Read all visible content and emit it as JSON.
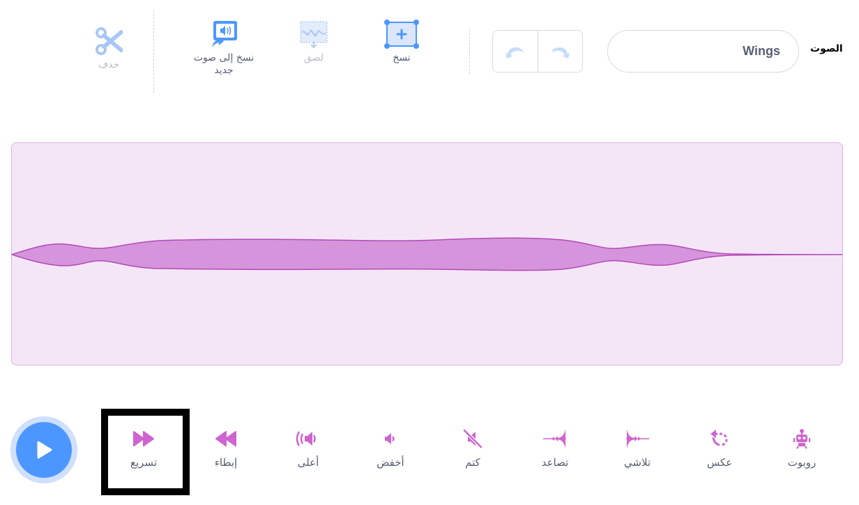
{
  "sound_name": {
    "label": "الصوت",
    "value": "Wings"
  },
  "history": {
    "undo_icon": "undo-icon",
    "redo_icon": "redo-icon"
  },
  "toolbar": {
    "copy": {
      "label": "نسخ",
      "icon": "copy-selection-icon"
    },
    "paste": {
      "label": "لصق",
      "icon": "paste-icon"
    },
    "copy_to_new": {
      "label": "نسخ إلى صوت جديد",
      "icon": "copy-to-new-icon"
    },
    "delete": {
      "label": "حذف",
      "icon": "scissors-icon"
    }
  },
  "effects": [
    {
      "label": "روبوت",
      "icon": "robot-icon"
    },
    {
      "label": "عكس",
      "icon": "reverse-icon"
    },
    {
      "label": "تلاشي",
      "icon": "fade-out-icon"
    },
    {
      "label": "تصاعد",
      "icon": "fade-in-icon"
    },
    {
      "label": "كتم",
      "icon": "mute-icon"
    },
    {
      "label": "أخفض",
      "icon": "softer-icon"
    },
    {
      "label": "أعلى",
      "icon": "louder-icon"
    },
    {
      "label": "إبطاء",
      "icon": "slower-icon"
    },
    {
      "label": "تسريع",
      "icon": "faster-icon"
    }
  ],
  "colors": {
    "effect_accent": "#cf63cf",
    "waveform_fill": "#d594dc",
    "waveform_background": "#f4e6f7",
    "play_button": "#4c97ff",
    "toolbar_blue": "#4c97ff"
  }
}
